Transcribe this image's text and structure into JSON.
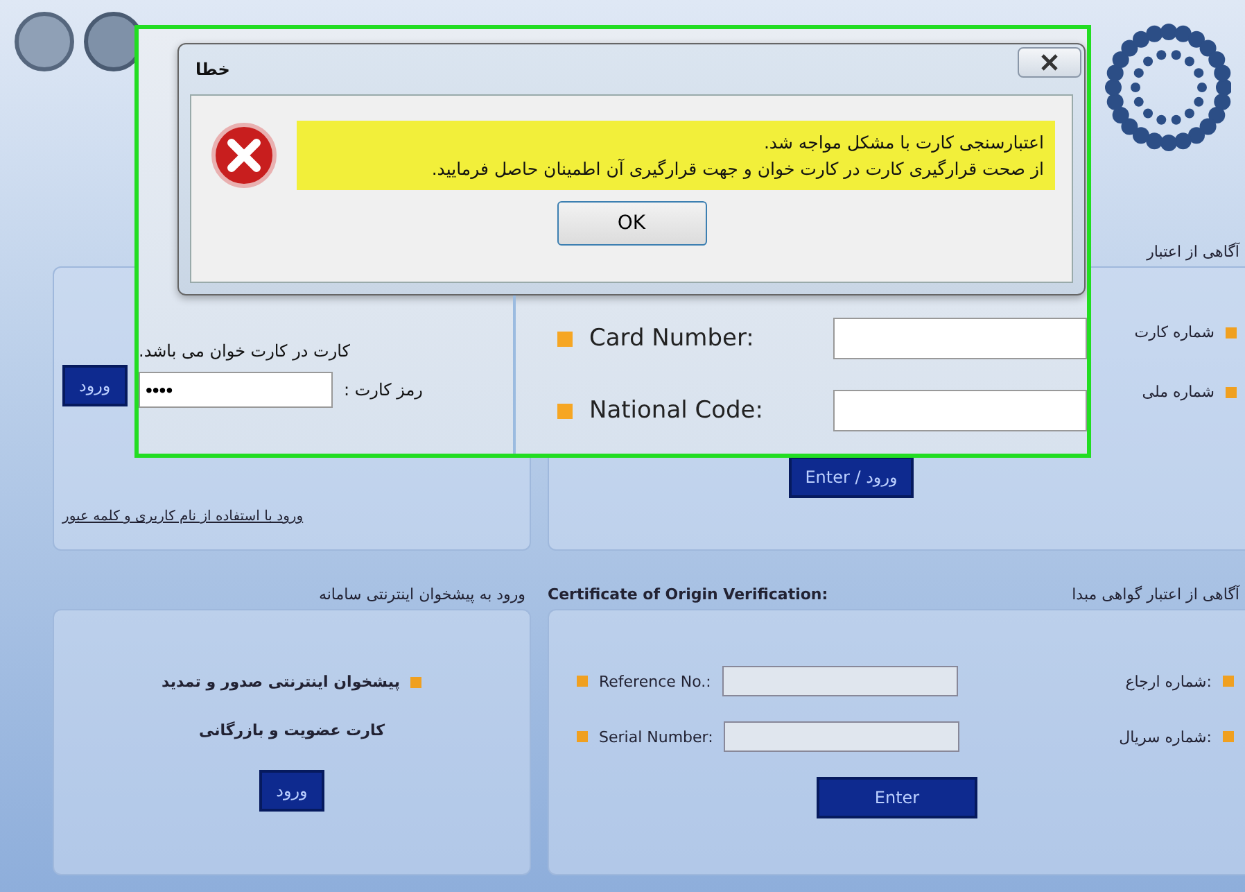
{
  "top_section": {
    "right_label": "آگاهی از اعتبار",
    "card_panel": {
      "button": "ورود"
    },
    "verify_panel": {
      "fields": [
        {
          "label": "شماره کارت"
        },
        {
          "label": "شماره ملی"
        }
      ],
      "button": "Enter / ورود"
    },
    "link": "ورود با استفاده از نام کاربری و کلمه عبور"
  },
  "bottom_section": {
    "left_label": "ورود به پیشخوان اینترنتی سامانه",
    "center_label": "Certificate of Origin Verification:",
    "right_label": "آگاهی از اعتبار گواهی مبدا",
    "left_panel": {
      "lines": [
        "پیشخوان اینترنتی صدور و تمدید",
        "کارت عضویت و بازرگانی"
      ],
      "button": "ورود"
    },
    "right_panel": {
      "fields": [
        {
          "label": "Reference No.:",
          "fa_label": "شماره ارجاع:"
        },
        {
          "label": "Serial Number:",
          "fa_label": "شماره سریال:"
        }
      ],
      "button": "Enter"
    }
  },
  "highlight": {
    "dialog": {
      "title": "خطا",
      "message_lines": [
        "اعتبارسنجی کارت با مشکل مواجه شد.",
        "از صحت قرارگیری کارت در کارت خوان و جهت قرارگیری آن اطمینان حاصل فرمایید."
      ],
      "button": "OK"
    },
    "card_reader": {
      "note": "کارت در کارت خوان می باشد.",
      "pin_label": "رمز کارت :",
      "pin_value": "••••"
    },
    "fields": [
      {
        "label": "Card Number:"
      },
      {
        "label": "National Code:"
      }
    ]
  }
}
